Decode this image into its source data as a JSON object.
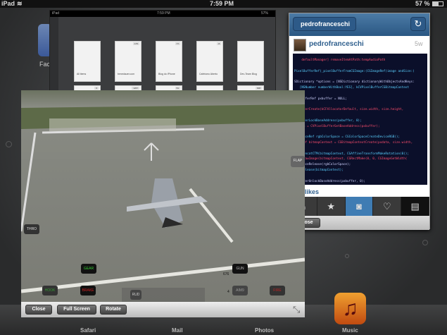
{
  "status_bar": {
    "device": "iPad",
    "time": "7:59 PM",
    "battery": "57 %",
    "wifi_icon": "wifi-icon",
    "battery_icon": "battery-icon"
  },
  "home": {
    "partial_app_label": "Fac"
  },
  "reeder": {
    "status": {
      "device": "iPad",
      "time": "7:59 PM",
      "battery": "57%"
    },
    "feeds": [
      {
        "title": "All items",
        "count": ""
      },
      {
        "title": "benedauer.com",
        "count": "175"
      },
      {
        "title": "Blog do iPhone",
        "count": "77"
      },
      {
        "title": "Cafeísmo Aberto",
        "count": "8"
      },
      {
        "title": "Dev-Team Blog",
        "count": ""
      }
    ],
    "row2_counts": [
      "6",
      "1267",
      "51",
      "",
      "608"
    ]
  },
  "instagram": {
    "back_label": "pedrofranceschi",
    "username": "pedrofranceschi",
    "time_ago": "5w",
    "likes": "likes",
    "close_label": "Close",
    "code_lines": [
      "    defaultManager] removeItemAtPath:tempAudioPath",
      "",
      "PixelBufferRef)_pixelBufferFromCGImage:(CGImageRef)image andSize:(",
      "",
      "SDictionary *options = [NSDictionary dictionaryWithObjectsAndKeys:",
      "   [NSNumber numberWithBool:YES], kCVPixelBufferCGBitmapContext",
      "",
      "xelBufferRef pxbuffer = NULL;",
      "",
      "elBufferCreate(kCFAllocatorDefault, size.width, size.height,",
      "",
      "elBufferLockBaseAddress(pxbuffer, 0);",
      "pxdata = CVPixelBufferGetBaseAddress(pxbuffer);",
      "",
      "lorSpaceRef rgbColorSpace = CGColorSpaceCreateDeviceRGB();",
      "textRef bitmapContext = CGBitmapContextCreate(pxdata, size.width,",
      "",
      "textConcatCTM(bitmapContext, CGAffineTransformMakeRotation(0));",
      "textDrawImage(bitmapContext, CGRectMake(0, 0, CGImageGetWidth(",
      "lorSpaceRelease(rgbColorSpace);",
      "textRelease(bitmapContext);",
      "",
      "elBufferUnlockBaseAddress(pxbuffer, 0);",
      "",
      "urn pxbuffer;"
    ],
    "tabs": [
      {
        "icon": "home-icon",
        "glyph": "⌂"
      },
      {
        "icon": "star-icon",
        "glyph": "★"
      },
      {
        "icon": "camera-icon",
        "glyph": "◙"
      },
      {
        "icon": "heart-bubble-icon",
        "glyph": "♡"
      },
      {
        "icon": "news-icon",
        "glyph": "▤"
      }
    ]
  },
  "game": {
    "hud": {
      "flap": "FLAP",
      "thro": "THRO",
      "gear": "GEAR",
      "gun": "GUN",
      "ammo": "676",
      "hook": "HOOK",
      "brake": "BRAKE",
      "rud": "RUD",
      "aim_count": "4",
      "aim": "AIM9",
      "fire": "FIRE"
    },
    "toolbar": {
      "close": "Close",
      "full_screen": "Full Screen",
      "rotate": "Rotate",
      "resize_icon": "resize-icon"
    }
  },
  "dock": {
    "apps": [
      "Safari",
      "Mail",
      "Photos",
      "Music"
    ]
  }
}
